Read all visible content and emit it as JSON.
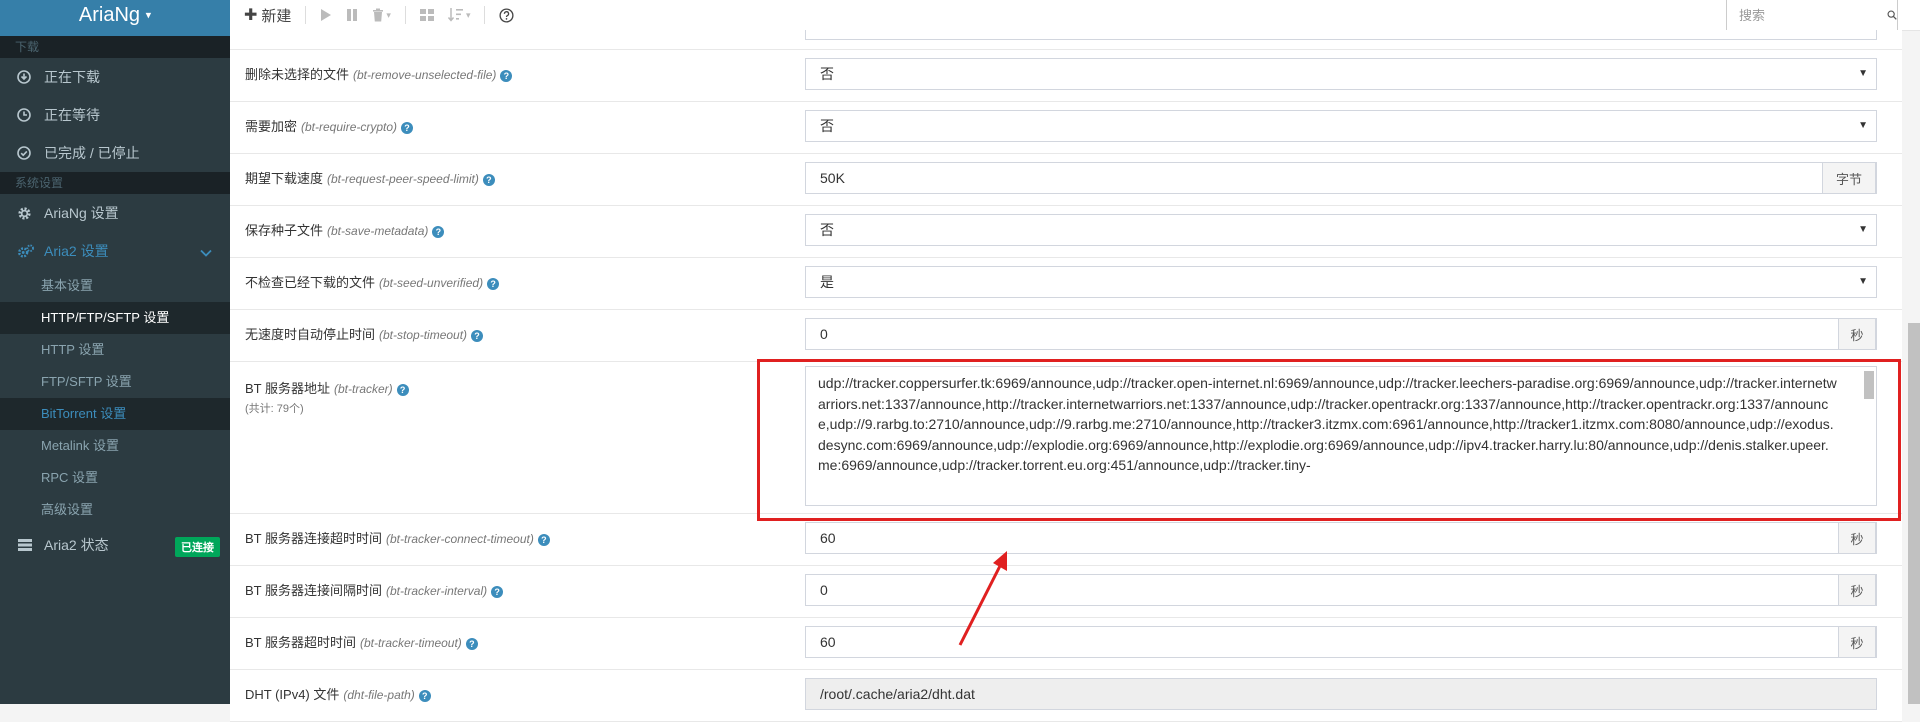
{
  "app": {
    "brand": "AriaNg"
  },
  "sidebar": {
    "section_download": "下载",
    "downloading": "正在下载",
    "waiting": "正在等待",
    "stopped": "已完成 / 已停止",
    "section_settings": "系统设置",
    "ariang_settings": "AriaNg 设置",
    "aria2_settings": "Aria2 设置",
    "sub": [
      "基本设置",
      "HTTP/FTP/SFTP 设置",
      "HTTP 设置",
      "FTP/SFTP 设置",
      "BitTorrent 设置",
      "Metalink 设置",
      "RPC 设置",
      "高级设置"
    ],
    "aria2_status": "Aria2 状态",
    "connected_badge": "已连接"
  },
  "toolbar": {
    "new_label": "新建",
    "search_placeholder": "搜索"
  },
  "rows": [
    {
      "label": "删除未选择的文件",
      "key": "(bt-remove-unselected-file)",
      "value": "否"
    },
    {
      "label": "需要加密",
      "key": "(bt-require-crypto)",
      "value": "否"
    },
    {
      "label": "期望下载速度",
      "key": "(bt-request-peer-speed-limit)",
      "value": "50K",
      "unit": "字节"
    },
    {
      "label": "保存种子文件",
      "key": "(bt-save-metadata)",
      "value": "否"
    },
    {
      "label": "不检查已经下载的文件",
      "key": "(bt-seed-unverified)",
      "value": "是"
    },
    {
      "label": "无速度时自动停止时间",
      "key": "(bt-stop-timeout)",
      "value": "0",
      "unit": "秒"
    },
    {
      "label": "BT 服务器地址",
      "key": "(bt-tracker)",
      "sub": "(共计: 79个)",
      "value": "udp://tracker.coppersurfer.tk:6969/announce,udp://tracker.open-internet.nl:6969/announce,udp://tracker.leechers-paradise.org:6969/announce,udp://tracker.internetwarriors.net:1337/announce,http://tracker.internetwarriors.net:1337/announce,udp://tracker.opentrackr.org:1337/announce,http://tracker.opentrackr.org:1337/announce,udp://9.rarbg.to:2710/announce,udp://9.rarbg.me:2710/announce,http://tracker3.itzmx.com:6961/announce,http://tracker1.itzmx.com:8080/announce,udp://exodus.desync.com:6969/announce,udp://explodie.org:6969/announce,http://explodie.org:6969/announce,udp://ipv4.tracker.harry.lu:80/announce,udp://denis.stalker.upeer.me:6969/announce,udp://tracker.torrent.eu.org:451/announce,udp://tracker.tiny-"
    },
    {
      "label": "BT 服务器连接超时时间",
      "key": "(bt-tracker-connect-timeout)",
      "value": "60",
      "unit": "秒"
    },
    {
      "label": "BT 服务器连接间隔时间",
      "key": "(bt-tracker-interval)",
      "value": "0",
      "unit": "秒"
    },
    {
      "label": "BT 服务器超时时间",
      "key": "(bt-tracker-timeout)",
      "value": "60",
      "unit": "秒"
    },
    {
      "label": "DHT (IPv4) 文件",
      "key": "(dht-file-path)",
      "value": "/root/.cache/aria2/dht.dat"
    }
  ],
  "colors": {
    "sidebar_bg": "#2c3b41",
    "brand_bg": "#367fa9",
    "accent": "#3c8dbc",
    "badge": "#00a65a",
    "highlight": "#e02020"
  }
}
